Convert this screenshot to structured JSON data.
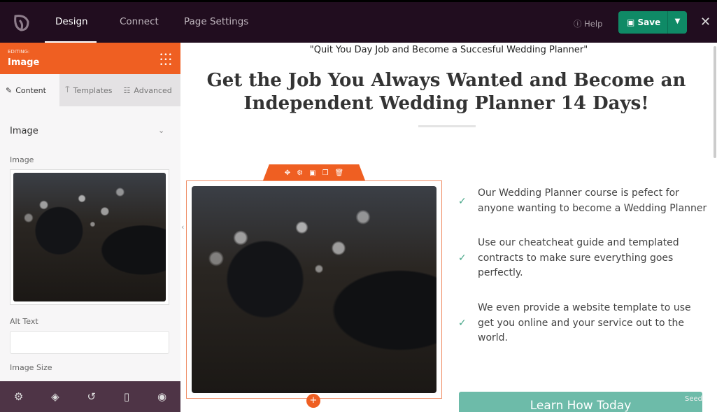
{
  "topbar": {
    "tabs": [
      {
        "label": "Design",
        "active": true
      },
      {
        "label": "Connect"
      },
      {
        "label": "Page Settings"
      }
    ],
    "help": "Help",
    "save": "Save"
  },
  "sidebar": {
    "editing_label": "EDITING:",
    "editing_name": "Image",
    "tabs": [
      {
        "label": "Content",
        "icon": "pencil-icon"
      },
      {
        "label": "Templates",
        "icon": "paint-roller-icon"
      },
      {
        "label": "Advanced",
        "icon": "sliders-icon"
      }
    ],
    "section": "Image",
    "image_label": "Image",
    "alt_label": "Alt Text",
    "alt_value": "",
    "size_label": "Image Size"
  },
  "canvas": {
    "quote": "\"Quit You Day Job and Become a Succesful Wedding Planner\"",
    "headline": "Get the Job You Always Wanted and Become an Independent Wedding Planner 14 Days!",
    "bullets": [
      "Our Wedding Planner course is pefect for anyone wanting to become a Wedding Planner",
      "Use our cheatcheat guide and templated contracts to make sure everything goes perfectly.",
      "We even provide a website template to use get you online and your service out to the world."
    ],
    "cta": "Learn How Today",
    "watermark": "Seed"
  },
  "colors": {
    "accent": "#ef5f22",
    "save": "#0f8a66",
    "topbar": "#210d1f",
    "cta": "#6dbba9"
  }
}
